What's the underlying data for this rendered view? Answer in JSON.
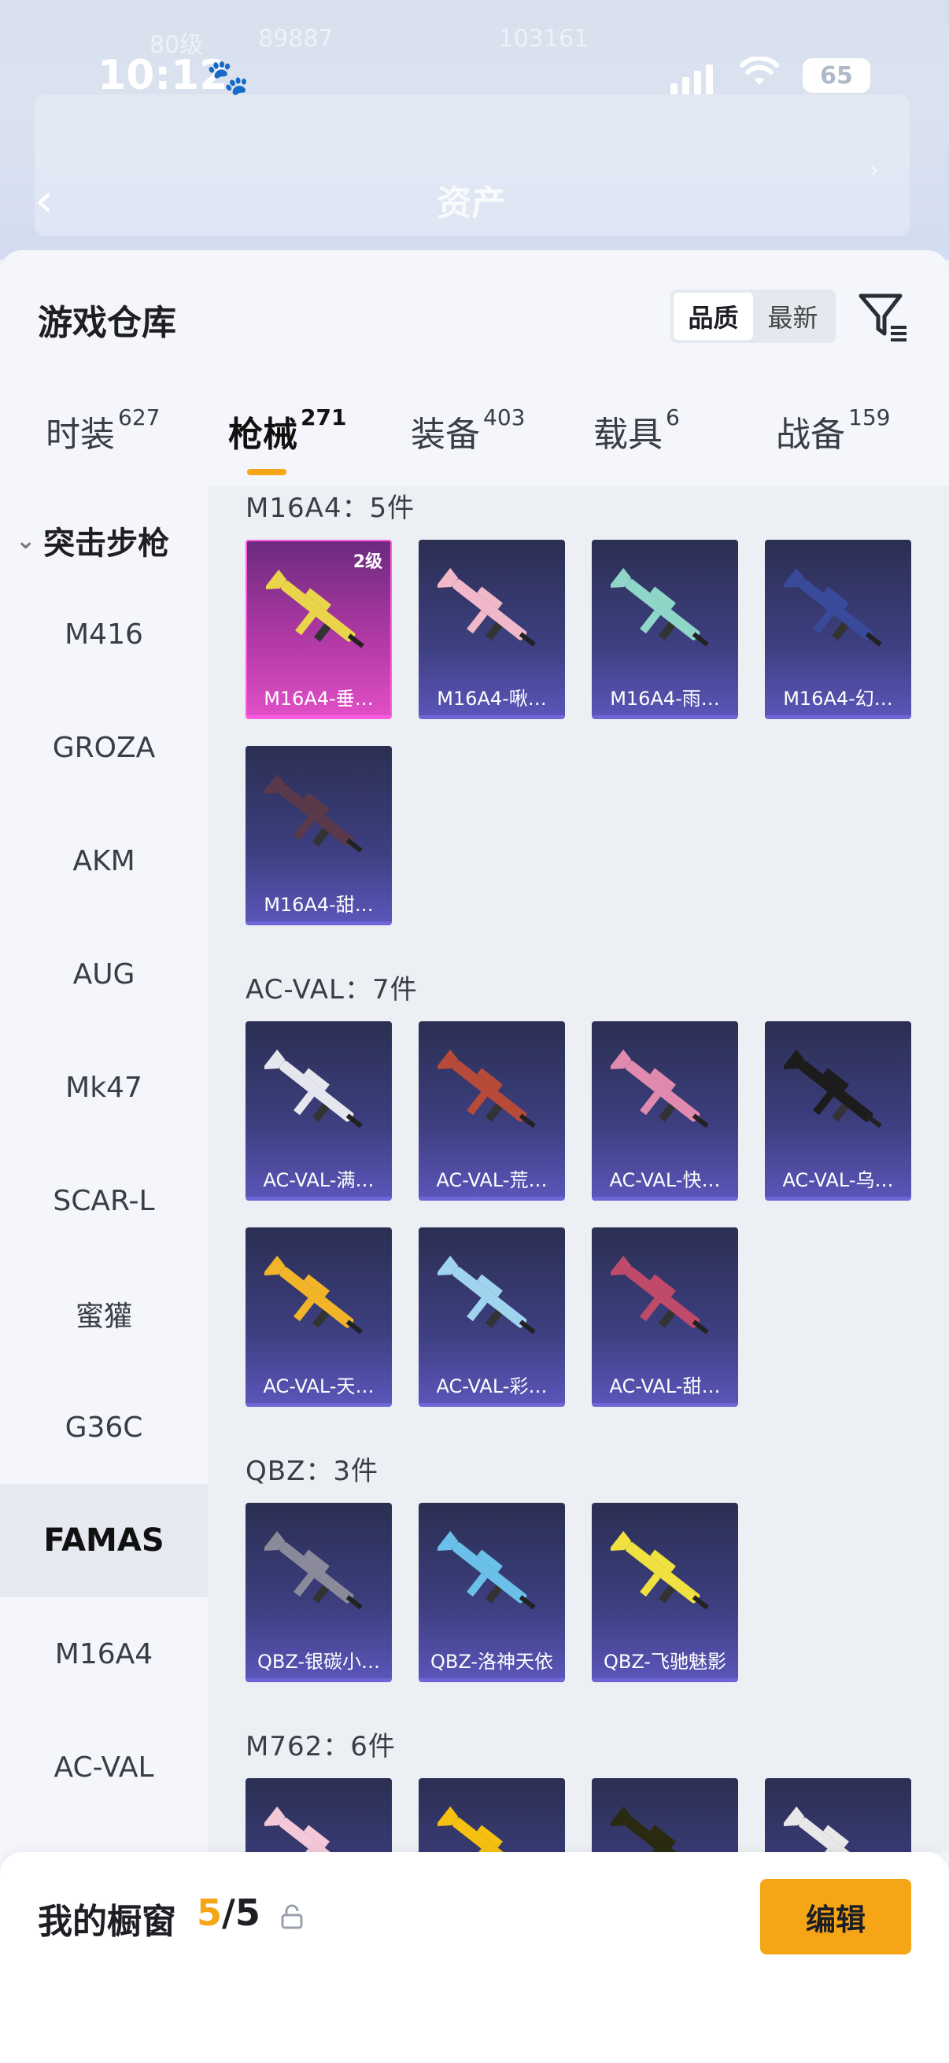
{
  "status_bar": {
    "time": "10:12",
    "battery": "65"
  },
  "background": {
    "ghost_title": "资产",
    "ghost_stats": [
      "80级",
      "89887",
      "103161"
    ]
  },
  "header": {
    "title": "游戏仓库",
    "sort_options": [
      "品质",
      "最新"
    ],
    "active_sort": "品质"
  },
  "tabs": [
    {
      "label": "时装",
      "count": "627"
    },
    {
      "label": "枪械",
      "count": "271"
    },
    {
      "label": "装备",
      "count": "403"
    },
    {
      "label": "载具",
      "count": "6"
    },
    {
      "label": "战备",
      "count": "159"
    }
  ],
  "sidebar": {
    "category": "突击步枪",
    "items": [
      "M416",
      "GROZA",
      "AKM",
      "AUG",
      "Mk47",
      "SCAR-L",
      "蜜獾",
      "G36C",
      "FAMAS",
      "M16A4",
      "AC-VAL"
    ],
    "active": "FAMAS"
  },
  "groups": [
    {
      "title": "M16A4：5件",
      "items": [
        {
          "name": "M16A4-垂…",
          "level": "2级",
          "rarity": "pink"
        },
        {
          "name": "M16A4-啾…"
        },
        {
          "name": "M16A4-雨…"
        },
        {
          "name": "M16A4-幻…"
        },
        {
          "name": "M16A4-甜…"
        }
      ]
    },
    {
      "title": "AC-VAL：7件",
      "items": [
        {
          "name": "AC-VAL-满…"
        },
        {
          "name": "AC-VAL-荒…"
        },
        {
          "name": "AC-VAL-快…"
        },
        {
          "name": "AC-VAL-乌…"
        },
        {
          "name": "AC-VAL-天…"
        },
        {
          "name": "AC-VAL-彩…"
        },
        {
          "name": "AC-VAL-甜…"
        }
      ]
    },
    {
      "title": "QBZ：3件",
      "items": [
        {
          "name": "QBZ-银碳小…"
        },
        {
          "name": "QBZ-洛神天依"
        },
        {
          "name": "QBZ-飞驰魅影"
        }
      ]
    },
    {
      "title": "M762：6件",
      "items": [
        {
          "name": ""
        },
        {
          "name": ""
        },
        {
          "name": ""
        },
        {
          "name": ""
        }
      ]
    }
  ],
  "gun_colors": [
    "#e9d44a",
    "#f0b8c8",
    "#8fd6c8",
    "#3a4a9a",
    "#5a3a4a",
    "#e6e6ee",
    "#b84a3a",
    "#e08ab0",
    "#1c1c1c",
    "#f2b52a",
    "#9fd3ee",
    "#c04a6a",
    "#8a8a9a",
    "#6ac0e8",
    "#f0e040",
    "#f4c8d8",
    "#f5c010",
    "#2a2a10",
    "#e8e8e8"
  ],
  "footer": {
    "label": "我的橱窗",
    "current": "5",
    "total": "/5",
    "edit_label": "编辑"
  },
  "accent_color": "#f5a516"
}
